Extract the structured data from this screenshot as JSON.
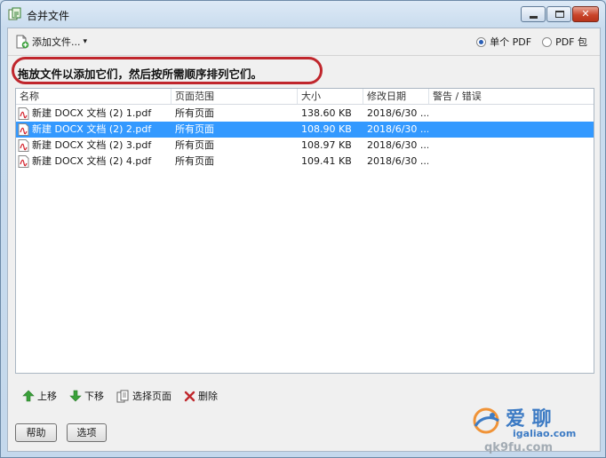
{
  "window": {
    "title": "合并文件",
    "min_glyph": "",
    "max_glyph": "",
    "close_glyph": "✕"
  },
  "toolbar": {
    "add_files_label": "添加文件...",
    "add_files_arrow": "▾",
    "mode_options": [
      {
        "label": "单个 PDF",
        "selected": true
      },
      {
        "label": "PDF 包",
        "selected": false
      }
    ]
  },
  "instruction": "拖放文件以添加它们，然后按所需顺序排列它们。",
  "list": {
    "columns": [
      "名称",
      "页面范围",
      "大小",
      "修改日期",
      "警告 / 错误"
    ],
    "rows": [
      {
        "name": "新建 DOCX 文档 (2) 1.pdf",
        "range": "所有页面",
        "size": "138.60 KB",
        "date": "2018/6/30 ...",
        "warning": "",
        "selected": false
      },
      {
        "name": "新建 DOCX 文档 (2) 2.pdf",
        "range": "所有页面",
        "size": "108.90 KB",
        "date": "2018/6/30 ...",
        "warning": "",
        "selected": true
      },
      {
        "name": "新建 DOCX 文档 (2) 3.pdf",
        "range": "所有页面",
        "size": "108.97 KB",
        "date": "2018/6/30 ...",
        "warning": "",
        "selected": false
      },
      {
        "name": "新建 DOCX 文档 (2) 4.pdf",
        "range": "所有页面",
        "size": "109.41 KB",
        "date": "2018/6/30 ...",
        "warning": "",
        "selected": false
      }
    ]
  },
  "actions": {
    "move_up": "上移",
    "move_down": "下移",
    "choose_pages": "选择页面",
    "delete": "删除"
  },
  "buttons": {
    "help": "帮助",
    "options": "选项"
  },
  "watermark": {
    "line1": "爱 聊",
    "line2": "igaliao.com",
    "line3": "qk9fu.com"
  },
  "colors": {
    "selection": "#3399ff",
    "instruction_circle": "#c0262c",
    "up_arrow": "#3aa13a",
    "delete_x": "#c0282d"
  }
}
